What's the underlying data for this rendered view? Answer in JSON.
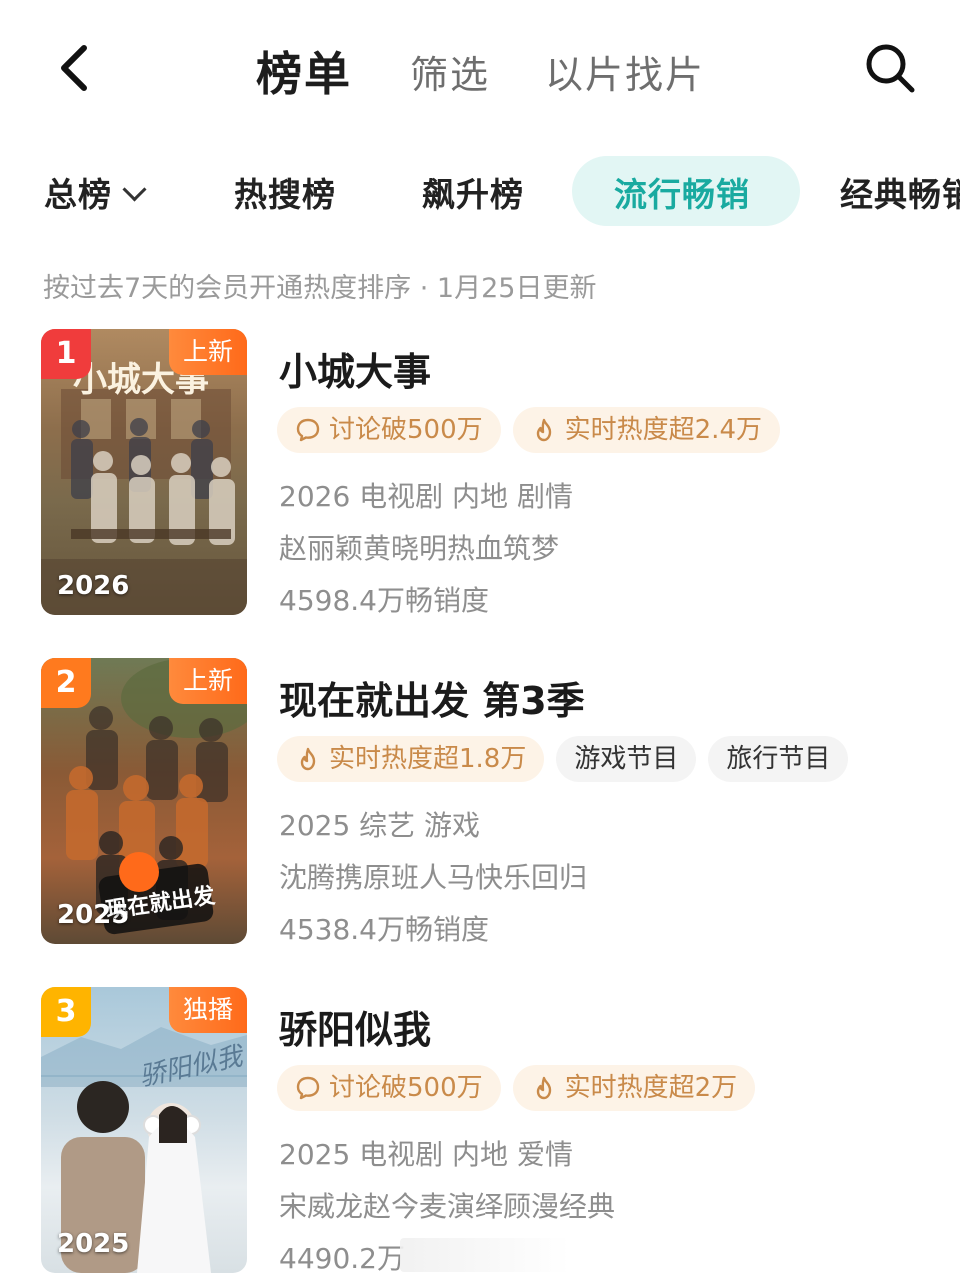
{
  "nav": {
    "title": "榜单",
    "filter": "筛选",
    "similar": "以片找片"
  },
  "categories": [
    {
      "label": "总榜"
    },
    {
      "label": "热搜榜"
    },
    {
      "label": "飙升榜"
    },
    {
      "label": "流行畅销",
      "active": true
    },
    {
      "label": "经典畅销"
    }
  ],
  "sort_desc": "按过去7天的会员开通热度排序 · 1月25日更新",
  "items": [
    {
      "rank": "1",
      "tag": "上新",
      "poster_year": "2026",
      "poster_text": "小城大事",
      "title": "小城大事",
      "badges": [
        {
          "icon": "comment-icon",
          "text": "讨论破500万"
        },
        {
          "icon": "flame-icon",
          "text": "实时热度超2.4万"
        }
      ],
      "meta": "2026 电视剧 内地 剧情",
      "desc": "赵丽颖黄晓明热血筑梦",
      "sales": "4598.4万畅销度"
    },
    {
      "rank": "2",
      "tag": "上新",
      "poster_year": "2025",
      "poster_text": "现在就出发",
      "title": "现在就出发 第3季",
      "badges": [
        {
          "icon": "flame-icon",
          "text": "实时热度超1.8万"
        },
        {
          "text": "游戏节目"
        },
        {
          "text": "旅行节目"
        }
      ],
      "meta": "2025 综艺 游戏",
      "desc": "沈腾携原班人马快乐回归",
      "sales": "4538.4万畅销度"
    },
    {
      "rank": "3",
      "tag": "独播",
      "poster_year": "2025",
      "poster_text": "骄阳似我",
      "title": "骄阳似我",
      "badges": [
        {
          "icon": "comment-icon",
          "text": "讨论破500万"
        },
        {
          "icon": "flame-icon",
          "text": "实时热度超2万"
        }
      ],
      "meta": "2025 电视剧 内地 爱情",
      "desc": "宋威龙赵今麦演绎顾漫经典",
      "sales": "4490.2万"
    }
  ],
  "colors": {
    "accent": "#19aaa0",
    "accent_bg": "#e2f6f4",
    "rank1": "#f03c3c",
    "rank2": "#ff7a1e",
    "rank3": "#ffb400",
    "tag": "#ff7a2a",
    "badge_text": "#c98a4a",
    "badge_bg": "#fdf3e7"
  }
}
